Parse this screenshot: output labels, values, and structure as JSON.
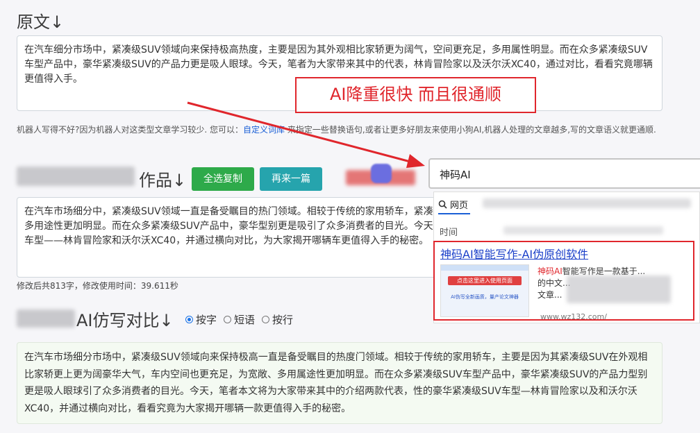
{
  "original": {
    "heading": "原文↓",
    "text": "在汽车细分市场中，紧凑级SUV领域向来保持极高热度，主要是因为其外观相比家轿更为阔气，空间更充足，多用属性明显。而在众多紧凑级SUV车型产品中，豪华紧凑级SUV的产品力更是吸人眼球。今天，笔者为大家带来其中的代表，林肯冒险家以及沃尔沃XC40，通过对比，看看究竟哪辆更值得入手。"
  },
  "callout": {
    "text": "AI降重很快 而且很通顺"
  },
  "hint": {
    "before": "机器人写得不好?因为机器人对这类型文章学习较少. 您可以：",
    "link": "自定义词库",
    "after": " 来指定一些替换语句,或者让更多好朋友来使用小狗AI,机器人处理的文章越多,写的文章语义就更通顺."
  },
  "works": {
    "heading_suffix": "作品↓",
    "copy_all_label": "全选复制",
    "again_label": "再来一篇",
    "text": "在汽车市场细分中，紧凑级SUV领域一直是备受瞩目的热门领域。相较于传统的家用轿车，紧凑级SUV在外观上更为阔气，车内空间也更为宽敞、多用途性更加明显。而在众多紧凑级SUV产品中，豪华型别更是吸引了众多消费者的目光。今天，笔者将为大家介绍两款代表性的豪华紧凑级SUV车型——林肯冒险家和沃尔沃XC40，并通过横向对比，为大家揭开哪辆车更值得入手的秘密。",
    "stats": "修改后共813字，修改使用时间：39.611秒"
  },
  "search": {
    "query": "神码AI",
    "tab_web": "网页",
    "time_label": "时间",
    "result_title": "神码AI智能写作-AI伪原创软件",
    "result_snippet_lead": "神码AI",
    "result_snippet_rest": "智能写作是一款基于...",
    "result_snippet_line2": "的中文...",
    "result_snippet_line3": "文章...",
    "result_url": "www.wz132.com/",
    "thumb_line1": "点击这里进入使用页面",
    "thumb_line2": "AI伪写全新画质，量产论文神器"
  },
  "compare": {
    "heading_ai": "AI仿写对比↓",
    "options": [
      "按字",
      "短语",
      "按行"
    ],
    "selected": 0,
    "text": "在汽车市场细分市场中，紧凑级SUV领域向来保持极高一直是备受瞩目的热度门领域。相较于传统的家用轿车，主要是因为其紧凑级SUV在外观相比家轿更上更为阔豪华大气，车内空间也更充足，为宽敞、多用属途性更加明显。而在众多紧凑级SUV车型产品中，豪华紧凑级SUV的产品力型别更是吸人眼球引了众多消费者的目光。今天，笔者本文将为大家带来其中的介绍两款代表，性的豪华紧凑级SUV车型—林肯冒险家以及和沃尔沃XC40，并通过横向对比，看看究竟为大家揭开哪辆一款更值得入手的秘密。"
  },
  "colors": {
    "green": "#2eaa4a",
    "teal": "#26a4ad",
    "red": "#e0262c",
    "link": "#1a5fd6"
  }
}
